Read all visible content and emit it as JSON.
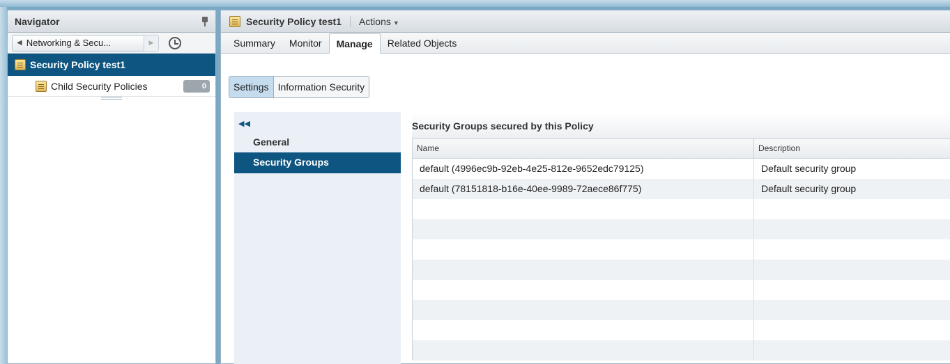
{
  "navigator": {
    "title": "Navigator",
    "back_label": "Networking & Secu...",
    "selected_item": "Security Policy test1",
    "child_item": "Child Security Policies",
    "child_count": "0"
  },
  "header": {
    "title": "Security Policy test1",
    "actions_label": "Actions"
  },
  "tabs": [
    {
      "label": "Summary"
    },
    {
      "label": "Monitor"
    },
    {
      "label": "Manage"
    },
    {
      "label": "Related Objects"
    }
  ],
  "subtabs": [
    {
      "label": "Settings"
    },
    {
      "label": "Information Security"
    }
  ],
  "leftnav": {
    "items": [
      {
        "label": "General"
      },
      {
        "label": "Security Groups"
      }
    ]
  },
  "section": {
    "title": "Security Groups secured by this Policy"
  },
  "table": {
    "columns": [
      "Name",
      "Description"
    ],
    "rows": [
      {
        "name": "default (4996ec9b-92eb-4e25-812e-9652edc79125)",
        "description": "Default security group"
      },
      {
        "name": "default (78151818-b16e-40ee-9989-72aece86f775)",
        "description": "Default security group"
      }
    ]
  },
  "colors": {
    "selected_bg": "#0e5681",
    "frame": "#7aa9c6"
  }
}
